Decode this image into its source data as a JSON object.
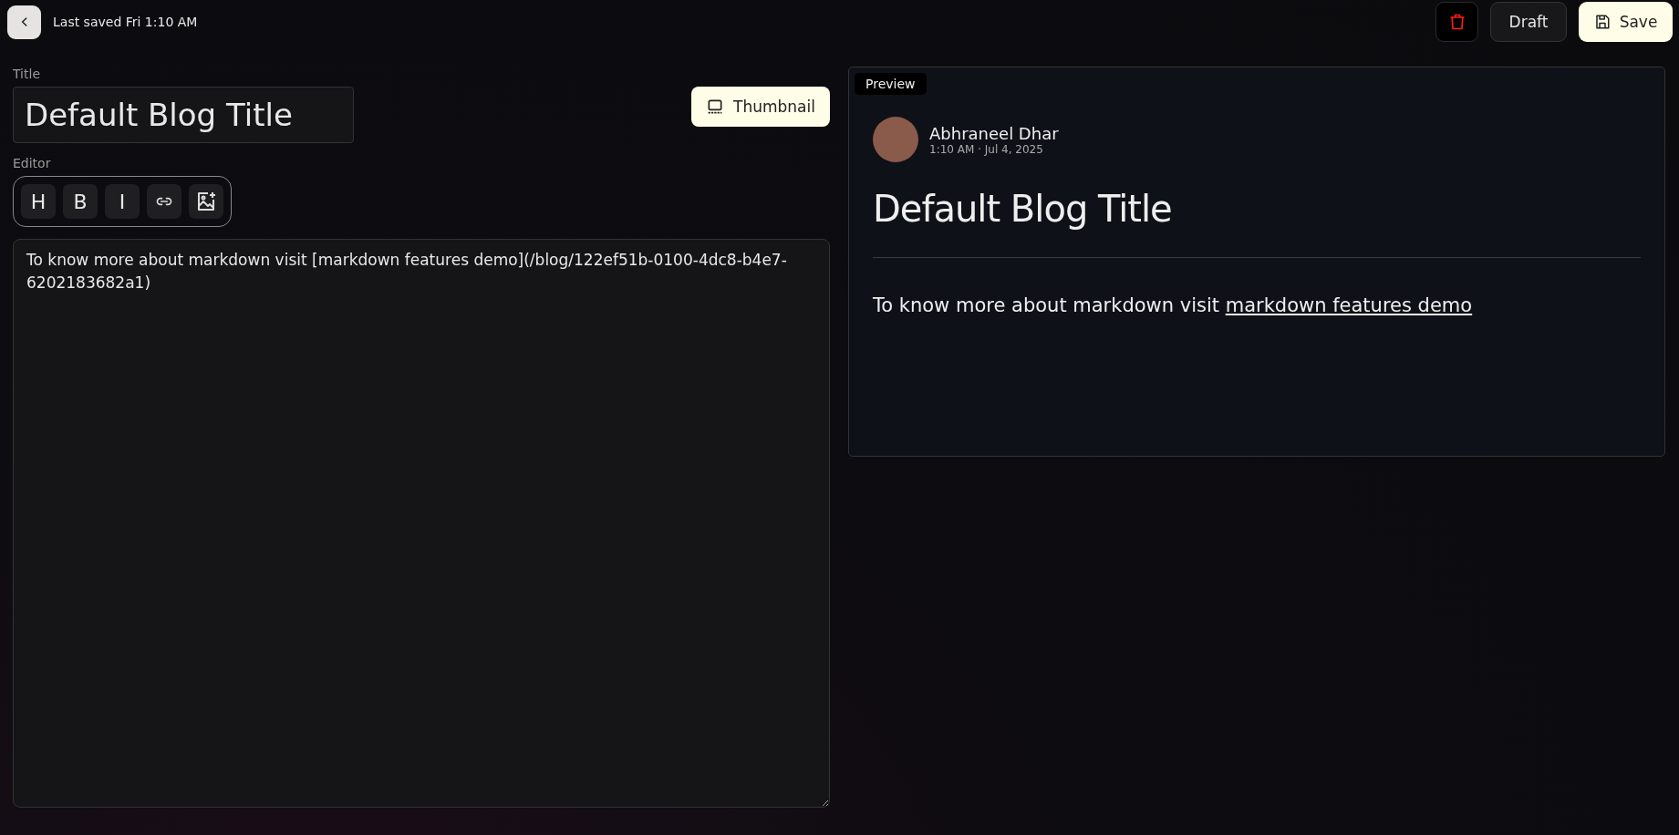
{
  "header": {
    "status": "Last saved Fri 1:10 AM"
  },
  "actions": [
    {
      "kind": "delete"
    },
    {
      "kind": "draft",
      "label": "Draft"
    },
    {
      "kind": "save",
      "label": "Save"
    }
  ],
  "title_field": {
    "label": "Title",
    "value": "Default Blog Title"
  },
  "thumbnail_button": {
    "label": "Thumbnail"
  },
  "editor": {
    "label": "Editor",
    "toolbar": [
      {
        "kind": "text",
        "label": "H"
      },
      {
        "kind": "text",
        "label": "B"
      },
      {
        "kind": "text",
        "label": "I"
      },
      {
        "kind": "link"
      },
      {
        "kind": "image"
      }
    ],
    "value": "To know more about markdown visit [markdown features demo](/blog/122ef51b-0100-4dc8-b4e7-6202183682a1)"
  },
  "preview": {
    "badge": "Preview",
    "author": "Abhraneel Dhar",
    "meta": "1:10 AM · Jul 4, 2025",
    "title": "Default Blog Title",
    "body": "To know more about markdown visit ",
    "link": "markdown features demo"
  }
}
